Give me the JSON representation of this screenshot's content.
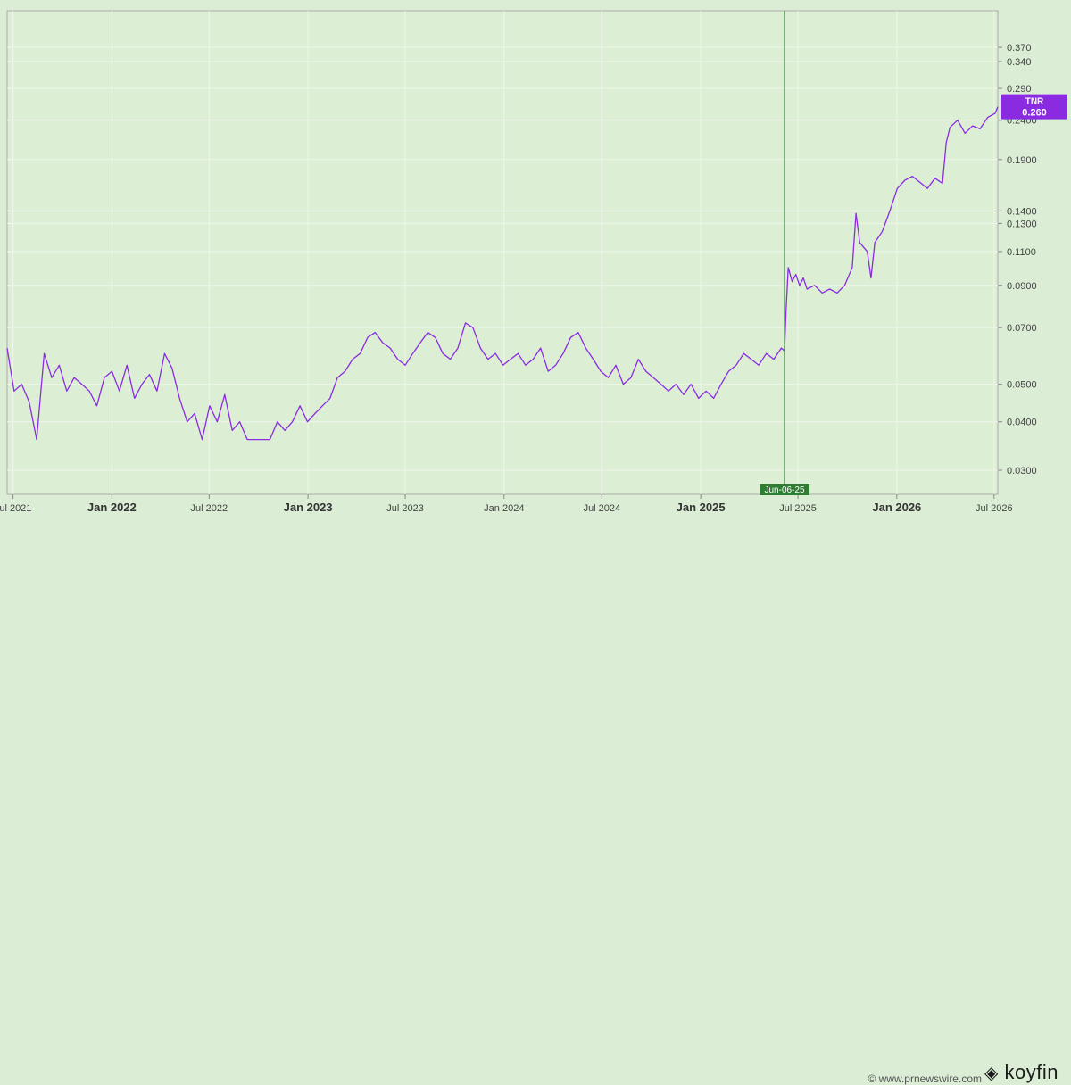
{
  "chart_data": {
    "type": "line",
    "scale": "log",
    "ylim": [
      0.026,
      0.46
    ],
    "grid": true,
    "y_ticks": [
      "0.370",
      "0.340",
      "0.290",
      "0.2400",
      "0.1900",
      "0.1400",
      "0.1300",
      "0.1100",
      "0.0900",
      "0.0700",
      "0.0500",
      "0.0400",
      "0.0300"
    ],
    "x_ticks": [
      {
        "date": "2021-07-01",
        "label": "Jul 2021",
        "major": false
      },
      {
        "date": "2022-01-01",
        "label": "Jan 2022",
        "major": true
      },
      {
        "date": "2022-07-01",
        "label": "Jul 2022",
        "major": false
      },
      {
        "date": "2023-01-01",
        "label": "Jan 2023",
        "major": true
      },
      {
        "date": "2023-07-01",
        "label": "Jul 2023",
        "major": false
      },
      {
        "date": "2024-01-01",
        "label": "Jan 2024",
        "major": false
      },
      {
        "date": "2024-07-01",
        "label": "Jul 2024",
        "major": false
      },
      {
        "date": "2025-01-01",
        "label": "Jan 2025",
        "major": true
      },
      {
        "date": "2025-07-01",
        "label": "Jul 2025",
        "major": false
      },
      {
        "date": "2026-01-01",
        "label": "Jan 2026",
        "major": true
      },
      {
        "date": "2026-07-01",
        "label": "Jul 2026",
        "major": false
      }
    ],
    "xlim": [
      "2021-06-20",
      "2026-07-08"
    ],
    "series": [
      {
        "name": "TNR",
        "color": "#8a2be2",
        "last_value": "0.260",
        "points": [
          [
            "2021-06-20",
            0.062
          ],
          [
            "2021-07-03",
            0.048
          ],
          [
            "2021-07-17",
            0.05
          ],
          [
            "2021-07-31",
            0.045
          ],
          [
            "2021-08-14",
            0.036
          ],
          [
            "2021-08-28",
            0.06
          ],
          [
            "2021-09-11",
            0.052
          ],
          [
            "2021-09-25",
            0.056
          ],
          [
            "2021-10-09",
            0.048
          ],
          [
            "2021-10-23",
            0.052
          ],
          [
            "2021-11-06",
            0.05
          ],
          [
            "2021-11-20",
            0.048
          ],
          [
            "2021-12-04",
            0.044
          ],
          [
            "2021-12-18",
            0.052
          ],
          [
            "2022-01-01",
            0.054
          ],
          [
            "2022-01-15",
            0.048
          ],
          [
            "2022-01-29",
            0.056
          ],
          [
            "2022-02-12",
            0.046
          ],
          [
            "2022-02-26",
            0.05
          ],
          [
            "2022-03-12",
            0.053
          ],
          [
            "2022-03-26",
            0.048
          ],
          [
            "2022-04-09",
            0.06
          ],
          [
            "2022-04-23",
            0.055
          ],
          [
            "2022-05-07",
            0.046
          ],
          [
            "2022-05-21",
            0.04
          ],
          [
            "2022-06-04",
            0.042
          ],
          [
            "2022-06-18",
            0.036
          ],
          [
            "2022-07-02",
            0.044
          ],
          [
            "2022-07-16",
            0.04
          ],
          [
            "2022-07-30",
            0.047
          ],
          [
            "2022-08-13",
            0.038
          ],
          [
            "2022-08-27",
            0.04
          ],
          [
            "2022-09-10",
            0.036
          ],
          [
            "2022-09-24",
            0.036
          ],
          [
            "2022-10-08",
            0.036
          ],
          [
            "2022-10-22",
            0.036
          ],
          [
            "2022-11-05",
            0.04
          ],
          [
            "2022-11-19",
            0.038
          ],
          [
            "2022-12-03",
            0.04
          ],
          [
            "2022-12-17",
            0.044
          ],
          [
            "2022-12-31",
            0.04
          ],
          [
            "2023-01-14",
            0.042
          ],
          [
            "2023-01-28",
            0.044
          ],
          [
            "2023-02-11",
            0.046
          ],
          [
            "2023-02-25",
            0.052
          ],
          [
            "2023-03-11",
            0.054
          ],
          [
            "2023-03-25",
            0.058
          ],
          [
            "2023-04-08",
            0.06
          ],
          [
            "2023-04-22",
            0.066
          ],
          [
            "2023-05-06",
            0.068
          ],
          [
            "2023-05-20",
            0.064
          ],
          [
            "2023-06-03",
            0.062
          ],
          [
            "2023-06-17",
            0.058
          ],
          [
            "2023-07-01",
            0.056
          ],
          [
            "2023-07-15",
            0.06
          ],
          [
            "2023-07-29",
            0.064
          ],
          [
            "2023-08-12",
            0.068
          ],
          [
            "2023-08-26",
            0.066
          ],
          [
            "2023-09-09",
            0.06
          ],
          [
            "2023-09-23",
            0.058
          ],
          [
            "2023-10-07",
            0.062
          ],
          [
            "2023-10-21",
            0.072
          ],
          [
            "2023-11-04",
            0.07
          ],
          [
            "2023-11-18",
            0.062
          ],
          [
            "2023-12-02",
            0.058
          ],
          [
            "2023-12-16",
            0.06
          ],
          [
            "2023-12-30",
            0.056
          ],
          [
            "2024-01-13",
            0.058
          ],
          [
            "2024-01-27",
            0.06
          ],
          [
            "2024-02-10",
            0.056
          ],
          [
            "2024-02-24",
            0.058
          ],
          [
            "2024-03-09",
            0.062
          ],
          [
            "2024-03-23",
            0.054
          ],
          [
            "2024-04-06",
            0.056
          ],
          [
            "2024-04-20",
            0.06
          ],
          [
            "2024-05-04",
            0.066
          ],
          [
            "2024-05-18",
            0.068
          ],
          [
            "2024-06-01",
            0.062
          ],
          [
            "2024-06-15",
            0.058
          ],
          [
            "2024-06-29",
            0.054
          ],
          [
            "2024-07-13",
            0.052
          ],
          [
            "2024-07-27",
            0.056
          ],
          [
            "2024-08-10",
            0.05
          ],
          [
            "2024-08-24",
            0.052
          ],
          [
            "2024-09-07",
            0.058
          ],
          [
            "2024-09-21",
            0.054
          ],
          [
            "2024-10-05",
            0.052
          ],
          [
            "2024-10-19",
            0.05
          ],
          [
            "2024-11-02",
            0.048
          ],
          [
            "2024-11-16",
            0.05
          ],
          [
            "2024-11-30",
            0.047
          ],
          [
            "2024-12-14",
            0.05
          ],
          [
            "2024-12-28",
            0.046
          ],
          [
            "2025-01-11",
            0.048
          ],
          [
            "2025-01-25",
            0.046
          ],
          [
            "2025-02-08",
            0.05
          ],
          [
            "2025-02-22",
            0.054
          ],
          [
            "2025-03-08",
            0.056
          ],
          [
            "2025-03-22",
            0.06
          ],
          [
            "2025-04-05",
            0.058
          ],
          [
            "2025-04-19",
            0.056
          ],
          [
            "2025-05-03",
            0.06
          ],
          [
            "2025-05-17",
            0.058
          ],
          [
            "2025-05-31",
            0.062
          ],
          [
            "2025-06-06",
            0.061
          ],
          [
            "2025-06-09",
            0.078
          ],
          [
            "2025-06-13",
            0.1
          ],
          [
            "2025-06-20",
            0.092
          ],
          [
            "2025-06-27",
            0.096
          ],
          [
            "2025-07-04",
            0.09
          ],
          [
            "2025-07-11",
            0.094
          ],
          [
            "2025-07-18",
            0.088
          ],
          [
            "2025-08-01",
            0.09
          ],
          [
            "2025-08-15",
            0.086
          ],
          [
            "2025-08-29",
            0.088
          ],
          [
            "2025-09-12",
            0.086
          ],
          [
            "2025-09-26",
            0.09
          ],
          [
            "2025-10-10",
            0.1
          ],
          [
            "2025-10-17",
            0.138
          ],
          [
            "2025-10-24",
            0.116
          ],
          [
            "2025-11-07",
            0.11
          ],
          [
            "2025-11-14",
            0.094
          ],
          [
            "2025-11-21",
            0.116
          ],
          [
            "2025-12-05",
            0.124
          ],
          [
            "2025-12-19",
            0.14
          ],
          [
            "2026-01-02",
            0.16
          ],
          [
            "2026-01-16",
            0.168
          ],
          [
            "2026-01-30",
            0.172
          ],
          [
            "2026-02-13",
            0.166
          ],
          [
            "2026-02-27",
            0.16
          ],
          [
            "2026-03-13",
            0.17
          ],
          [
            "2026-03-27",
            0.165
          ],
          [
            "2026-04-03",
            0.21
          ],
          [
            "2026-04-10",
            0.23
          ],
          [
            "2026-04-24",
            0.24
          ],
          [
            "2026-05-08",
            0.222
          ],
          [
            "2026-05-22",
            0.232
          ],
          [
            "2026-06-05",
            0.228
          ],
          [
            "2026-06-19",
            0.244
          ],
          [
            "2026-07-03",
            0.25
          ],
          [
            "2026-07-08",
            0.26
          ]
        ]
      }
    ],
    "annotation": {
      "date": "2025-06-06",
      "label": "Jun-06-25",
      "color": "#2e7d32"
    }
  },
  "footer": {
    "credit": "© www.prnewswire.com",
    "brand": "koyfin"
  }
}
